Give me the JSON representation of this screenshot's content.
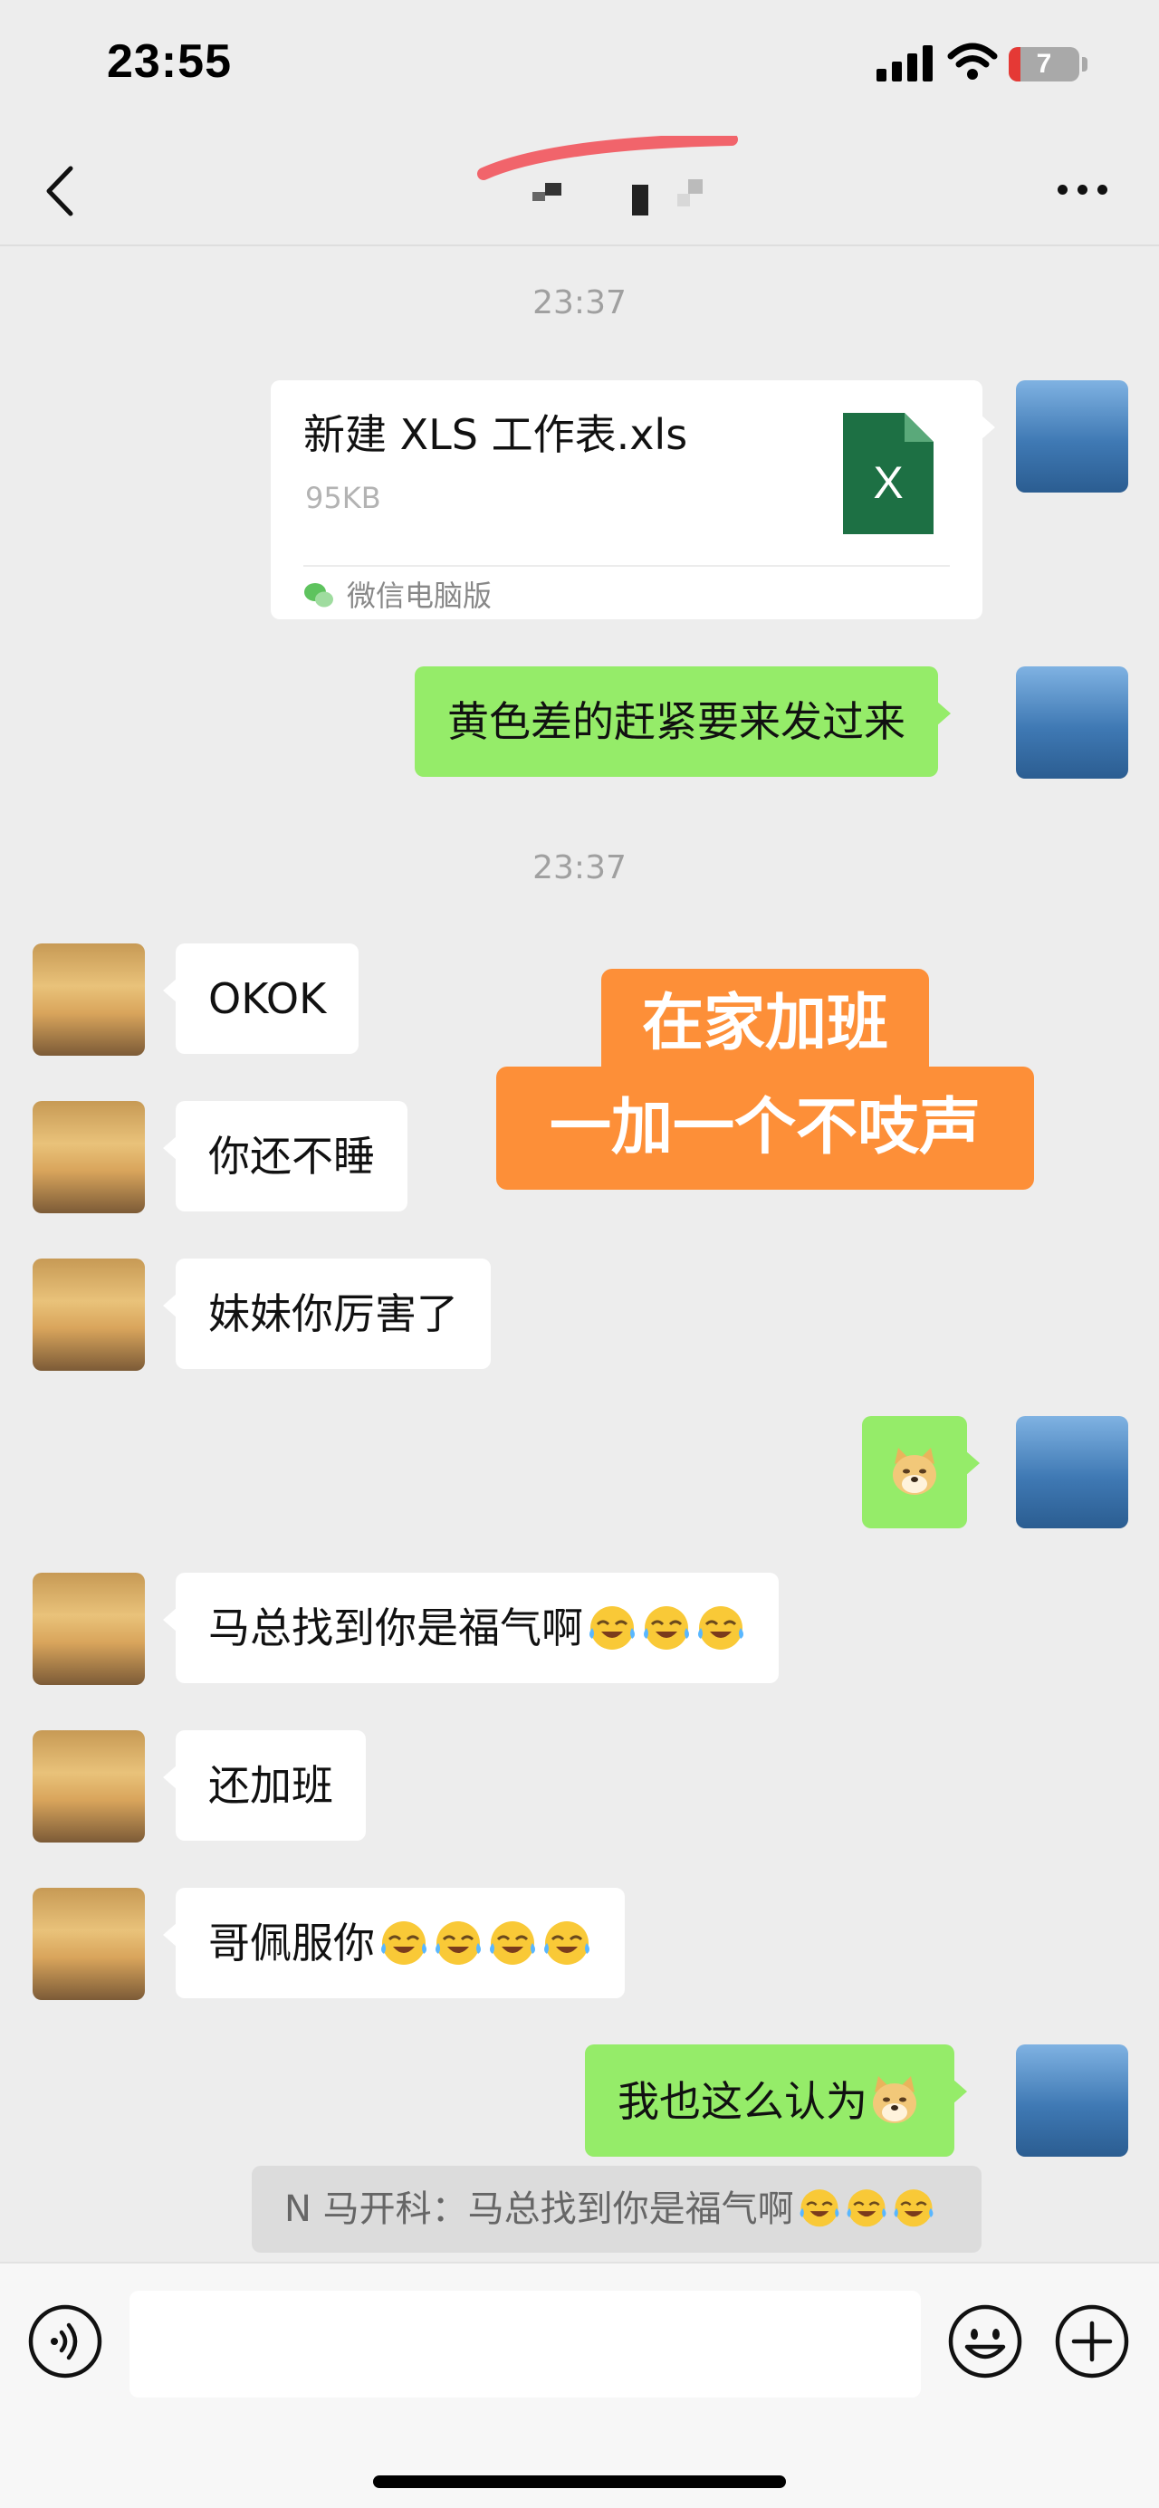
{
  "status_bar": {
    "time": "23:55",
    "battery_level": "7"
  },
  "chat": {
    "timestamps": [
      "23:37",
      "23:37"
    ],
    "file_message": {
      "file_name": "新建 XLS 工作表.xls",
      "file_size": "95KB",
      "file_icon_letter": "X",
      "source": "微信电脑版"
    },
    "messages": {
      "m1": "黄色差的赶紧要来发过来",
      "m2": "OKOK",
      "m3": "你还不睡",
      "m4": "妹妹你厉害了",
      "m6": "马总找到你是福气啊",
      "m7": "还加班",
      "m8": "哥佩服你",
      "m9": "我也这么认为"
    },
    "overlay": {
      "line1": "在家加班",
      "line2": "一加一个不吱声"
    },
    "quote": "N 马开科：马总找到你是福气啊"
  },
  "colors": {
    "background": "#ededed",
    "sent_bubble": "#95ec69",
    "received_bubble": "#ffffff",
    "overlay": "#fd8f38",
    "excel_green": "#1d7044"
  }
}
